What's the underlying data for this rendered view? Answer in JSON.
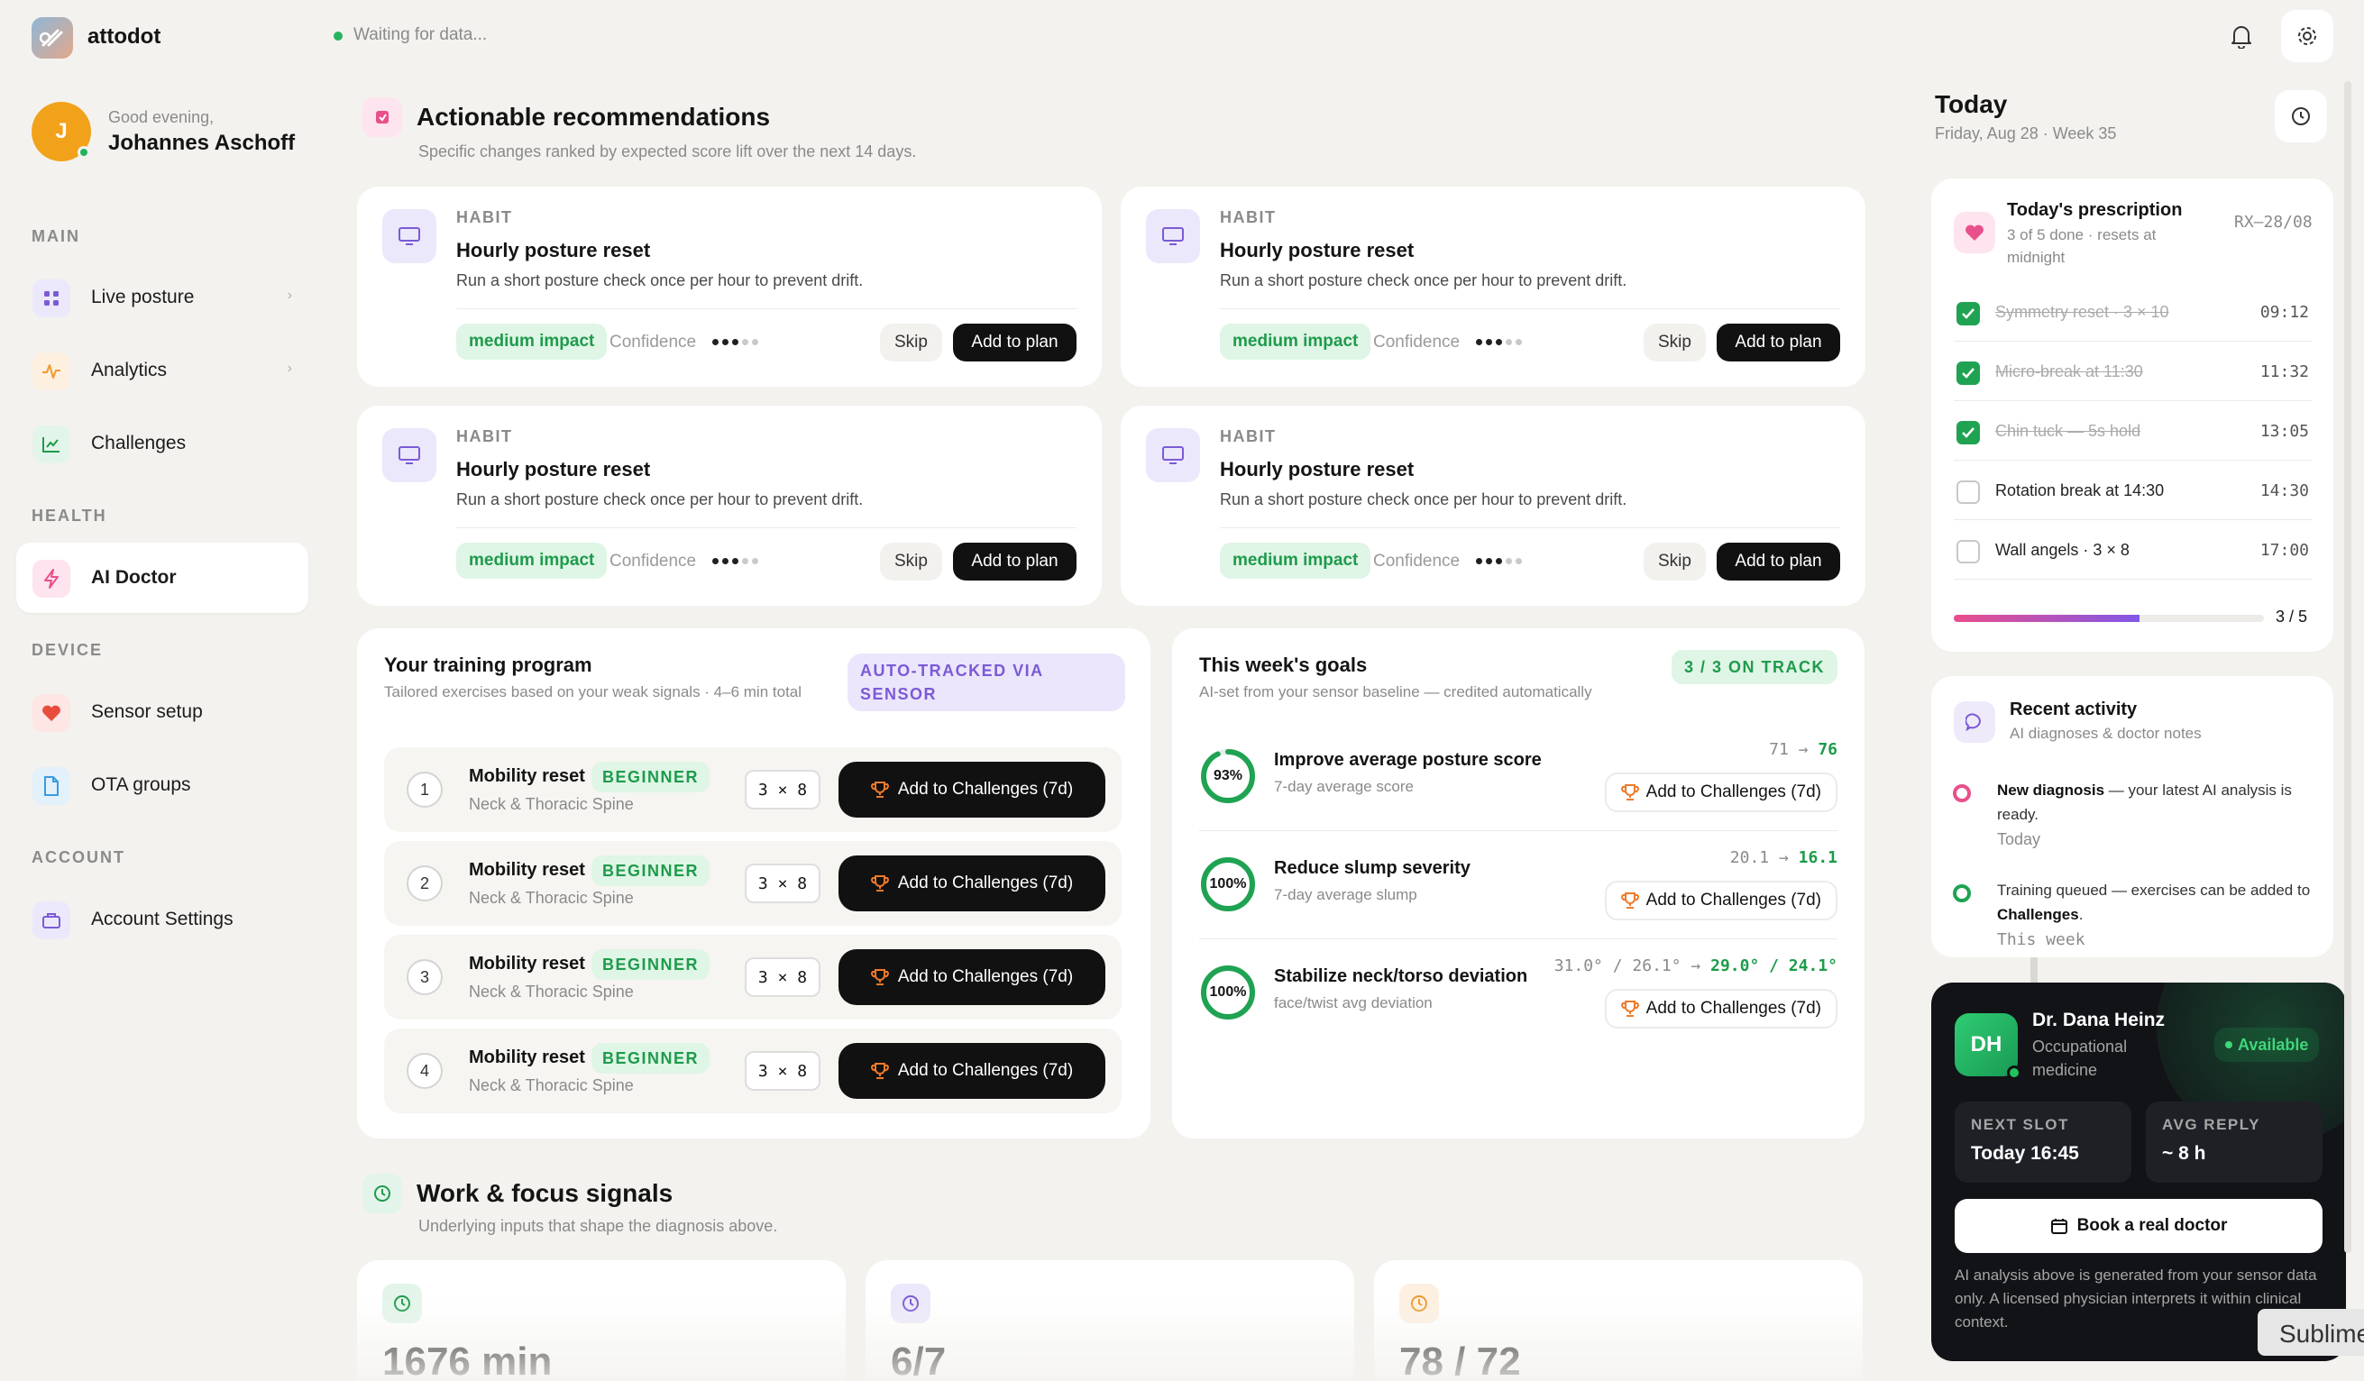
{
  "app": {
    "name": "attodot",
    "status_text": "Waiting for data..."
  },
  "user": {
    "greeting": "Good evening,",
    "name": "Johannes Aschoff",
    "initial": "J"
  },
  "sidebar": {
    "sections": [
      {
        "label": "MAIN",
        "items": [
          {
            "label": "Live posture"
          },
          {
            "label": "Analytics"
          },
          {
            "label": "Challenges"
          }
        ]
      },
      {
        "label": "HEALTH",
        "items": [
          {
            "label": "AI Doctor"
          }
        ]
      },
      {
        "label": "DEVICE",
        "items": [
          {
            "label": "Sensor setup"
          },
          {
            "label": "OTA groups"
          }
        ]
      },
      {
        "label": "ACCOUNT",
        "items": [
          {
            "label": "Account Settings"
          }
        ]
      }
    ],
    "active": "AI Doctor",
    "chevron": "›"
  },
  "recommendations": {
    "title": "Actionable recommendations",
    "subtitle": "Specific changes ranked by expected score lift over the next 14 days.",
    "cards": [
      {
        "kind": "HABIT",
        "title": "Hourly posture reset",
        "desc": "Run a short posture check once per hour to prevent drift.",
        "impact": "medium impact",
        "confidence_label": "Confidence",
        "confidence": 3,
        "skip": "Skip",
        "add": "Add to plan"
      },
      {
        "kind": "HABIT",
        "title": "Hourly posture reset",
        "desc": "Run a short posture check once per hour to prevent drift.",
        "impact": "medium impact",
        "confidence_label": "Confidence",
        "confidence": 3,
        "skip": "Skip",
        "add": "Add to plan"
      },
      {
        "kind": "HABIT",
        "title": "Hourly posture reset",
        "desc": "Run a short posture check once per hour to prevent drift.",
        "impact": "medium impact",
        "confidence_label": "Confidence",
        "confidence": 3,
        "skip": "Skip",
        "add": "Add to plan"
      },
      {
        "kind": "HABIT",
        "title": "Hourly posture reset",
        "desc": "Run a short posture check once per hour to prevent drift.",
        "impact": "medium impact",
        "confidence_label": "Confidence",
        "confidence": 3,
        "skip": "Skip",
        "add": "Add to plan"
      }
    ]
  },
  "training": {
    "title": "Your training program",
    "subtitle": "Tailored exercises based on your weak signals · 4–6 min total",
    "badge": "AUTO-TRACKED VIA SENSOR",
    "rows": [
      {
        "num": "1",
        "name": "Mobility reset",
        "level": "BEGINNER",
        "area": "Neck & Thoracic Spine",
        "sets": "3 × 8",
        "action": "Add to Challenges (7d)"
      },
      {
        "num": "2",
        "name": "Mobility reset",
        "level": "BEGINNER",
        "area": "Neck & Thoracic Spine",
        "sets": "3 × 8",
        "action": "Add to Challenges (7d)"
      },
      {
        "num": "3",
        "name": "Mobility reset",
        "level": "BEGINNER",
        "area": "Neck & Thoracic Spine",
        "sets": "3 × 8",
        "action": "Add to Challenges (7d)"
      },
      {
        "num": "4",
        "name": "Mobility reset",
        "level": "BEGINNER",
        "area": "Neck & Thoracic Spine",
        "sets": "3 × 8",
        "action": "Add to Challenges (7d)"
      }
    ]
  },
  "goals": {
    "title": "This week's goals",
    "subtitle": "AI-set from your sensor baseline — credited automatically",
    "badge": "3 / 3 ON TRACK",
    "items": [
      {
        "progress": 0.93,
        "pct": "93%",
        "title": "Improve average posture score",
        "sub": "7-day average score",
        "from": "71 →",
        "to": "76",
        "action": "Add to Challenges (7d)"
      },
      {
        "progress": 1.0,
        "pct": "100%",
        "title": "Reduce slump severity",
        "sub": "7-day average slump",
        "from": "20.1 →",
        "to": "16.1",
        "action": "Add to Challenges (7d)"
      },
      {
        "progress": 1.0,
        "pct": "100%",
        "title": "Stabilize neck/torso deviation",
        "sub": "face/twist avg deviation",
        "from": "31.0° / 26.1° →",
        "to": "29.0° / 24.1°",
        "action": "Add to Challenges (7d)"
      }
    ]
  },
  "signals": {
    "title": "Work & focus signals",
    "subtitle": "Underlying inputs that shape the diagnosis above.",
    "cards": [
      {
        "value": "1676 min"
      },
      {
        "value": "6/7"
      },
      {
        "value": "78 / 72"
      }
    ]
  },
  "today": {
    "title": "Today",
    "subtitle": "Friday, Aug 28 · Week 35",
    "prescription": {
      "title": "Today's prescription",
      "subtitle": "3 of 5 done · resets at midnight",
      "code": "RX–28/08",
      "items": [
        {
          "name": "Symmetry reset · 3 × 10",
          "time": "09:12",
          "done": true
        },
        {
          "name": "Micro-break at 11:30",
          "time": "11:32",
          "done": true
        },
        {
          "name": "Chin tuck — 5s hold",
          "time": "13:05",
          "done": true
        },
        {
          "name": "Rotation break at 14:30",
          "time": "14:30",
          "done": false
        },
        {
          "name": "Wall angels · 3 × 8",
          "time": "17:00",
          "done": false
        }
      ],
      "progress": 0.6,
      "count": "3 / 5"
    },
    "activity": {
      "title": "Recent activity",
      "subtitle": "AI diagnoses & doctor notes",
      "items": [
        {
          "bold": "New diagnosis",
          "text": " — your latest AI analysis is ready.",
          "time": "Today",
          "color": "#e8508b"
        },
        {
          "pre": "Training queued — exercises can be added to ",
          "bold": "Challenges",
          "post": ".",
          "time": "This week",
          "color": "#1fa352"
        }
      ]
    },
    "doctor": {
      "initials": "DH",
      "name": "Dr. Dana Heinz",
      "role": "Occupational medicine",
      "availability": "Available",
      "next_slot_label": "NEXT SLOT",
      "next_slot": "Today 16:45",
      "avg_reply_label": "AVG REPLY",
      "avg_reply": "~ 8 h",
      "book": "Book a real doctor",
      "note": "AI analysis above is generated from your sensor data only. A licensed physician interprets it within clinical context."
    }
  },
  "overlay": {
    "label": "Sublime"
  },
  "colors": {
    "accent_green": "#1e9b4b",
    "accent_pink": "#e8508b",
    "accent_violet": "#7b5ad6",
    "dark": "#111111"
  }
}
